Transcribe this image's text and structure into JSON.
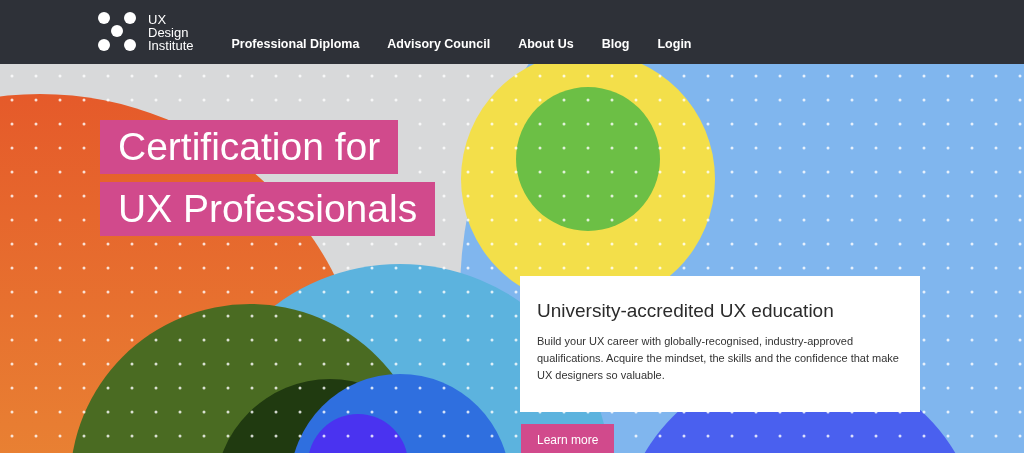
{
  "navbar": {
    "logo_text": "UX\nDesign\nInstitute",
    "links": [
      {
        "label": "Professional Diploma"
      },
      {
        "label": "Advisory Council"
      },
      {
        "label": "About Us"
      },
      {
        "label": "Blog"
      },
      {
        "label": "Login"
      }
    ]
  },
  "hero": {
    "kind": "picture",
    "title_lines": [
      "Certification for",
      "UX Professionals"
    ],
    "card": {
      "heading": "University-accredited UX education",
      "text": "Build your UX career with globally-recognised, industry-approved qualifications. Acquire the mindset, the skills and the confidence that make UX designers so valuable."
    },
    "button": "Learn more"
  }
}
